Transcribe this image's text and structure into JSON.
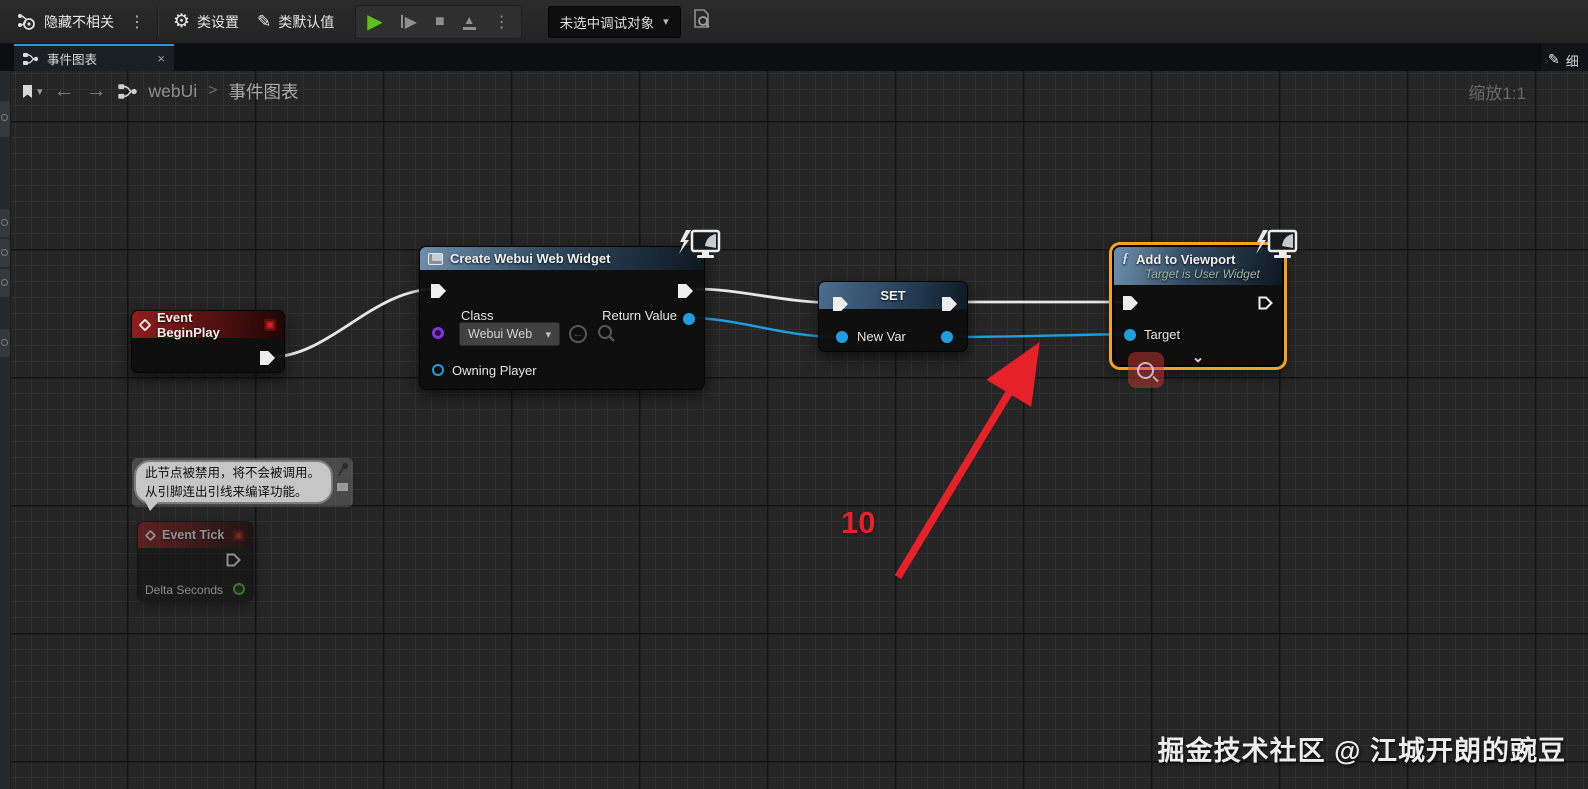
{
  "toolbar": {
    "hide_unrelated_label": "隐藏不相关",
    "class_settings_label": "类设置",
    "class_defaults_label": "类默认值",
    "debug_target_label": "未选中调试对象"
  },
  "icons": {
    "play": "▶",
    "stop": "■",
    "eject_triangle": "▲",
    "overflow_dots": "⋮",
    "dropdown_chevron": "▾",
    "back_arrow": "←",
    "forward_arrow": "→",
    "close": "×",
    "gear": "⚙",
    "pencil": "✎",
    "function_glyph": "ƒ",
    "expand_chevron": "⌄"
  },
  "tab_bar": {
    "active_tab": "事件图表",
    "right_panel_tab": "细"
  },
  "breadcrumb": {
    "root": "webUi",
    "separator": ">",
    "current": "事件图表"
  },
  "canvas": {
    "zoom_label": "缩放1:1"
  },
  "nodes": {
    "event_begin_play": {
      "title": "Event BeginPlay"
    },
    "create_widget": {
      "title": "Create Webui Web Widget",
      "class_label": "Class",
      "class_value": "Webui Web",
      "return_value_label": "Return Value",
      "owning_player_label": "Owning Player"
    },
    "set": {
      "title": "SET",
      "var_label": "New Var"
    },
    "add_to_viewport": {
      "title": "Add to Viewport",
      "subtitle": "Target is User Widget",
      "target_label": "Target"
    },
    "event_tick": {
      "title": "Event Tick",
      "delta_label": "Delta Seconds"
    }
  },
  "comment_bubble": {
    "line1": "此节点被禁用，将不会被调用。",
    "line2": "从引脚连出引线来编译功能。"
  },
  "annotation": {
    "number": "10"
  },
  "watermark": "掘金技术社区 @ 江城开朗的豌豆",
  "colors": {
    "accent_blue": "#1f9dde",
    "selection_orange": "#f7a21e",
    "event_red": "#941d1d",
    "annotation_red": "#e62129",
    "purple_pin": "#8134d6",
    "green_pin": "#46c02f"
  }
}
